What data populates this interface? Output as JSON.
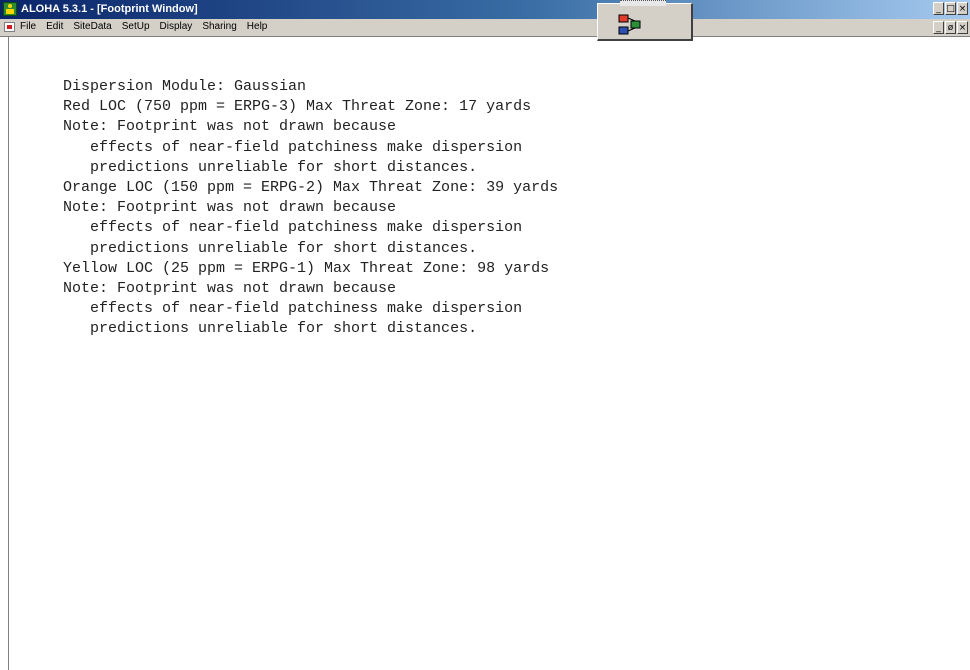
{
  "window": {
    "title": "ALOHA 5.3.1 - [Footprint Window]",
    "min_icon": "minimize-icon",
    "max_icon": "maximize-icon",
    "close_icon": "close-icon"
  },
  "menu": {
    "items": [
      "File",
      "Edit",
      "SiteData",
      "SetUp",
      "Display",
      "Sharing",
      "Help"
    ]
  },
  "toolbar": {
    "module_icon": "module-selector-icon",
    "colors": [
      "#e03a2a",
      "#2c8f3a",
      "#2d4fb0"
    ]
  },
  "report": {
    "lines": [
      "Dispersion Module: Gaussian",
      "Red LOC (750 ppm = ERPG-3) Max Threat Zone: 17 yards",
      "Note: Footprint was not drawn because",
      "   effects of near-field patchiness make dispersion",
      "   predictions unreliable for short distances.",
      "Orange LOC (150 ppm = ERPG-2) Max Threat Zone: 39 yards",
      "Note: Footprint was not drawn because",
      "   effects of near-field patchiness make dispersion",
      "   predictions unreliable for short distances.",
      "Yellow LOC (25 ppm = ERPG-1) Max Threat Zone: 98 yards",
      "Note: Footprint was not drawn because",
      "   effects of near-field patchiness make dispersion",
      "   predictions unreliable for short distances."
    ]
  }
}
